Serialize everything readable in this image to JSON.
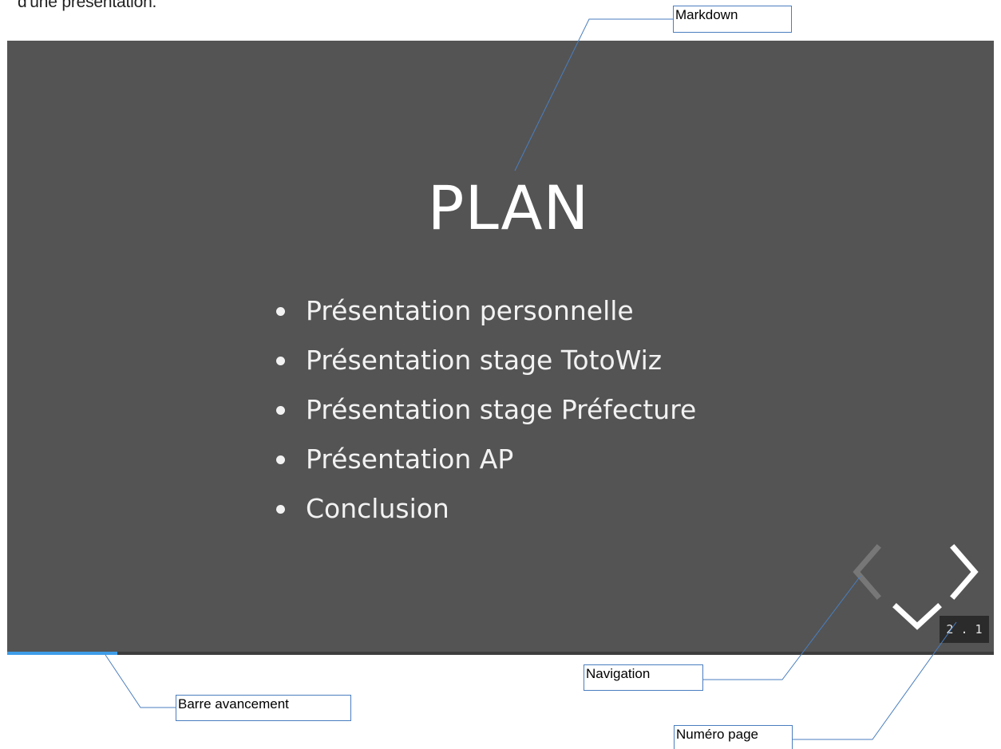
{
  "document": {
    "intro_text": "d'une présentation."
  },
  "slide": {
    "title": "PLAN",
    "items": [
      "Présentation personnelle",
      "Présentation stage TotoWiz",
      "Présentation stage Préfecture",
      "Présentation AP",
      "Conclusion"
    ],
    "background_color": "#545454",
    "page_number": "2 . 1",
    "progress_fraction": 0.112,
    "progress_color": "#3e9de8"
  },
  "navigation": {
    "prev_icon": "chevron-left-icon",
    "next_icon": "chevron-right-icon",
    "down_icon": "chevron-down-icon"
  },
  "callouts": {
    "markdown": "Markdown",
    "navigation": "Navigation",
    "progress_bar": "Barre avancement",
    "page_number": "Numéro page"
  }
}
